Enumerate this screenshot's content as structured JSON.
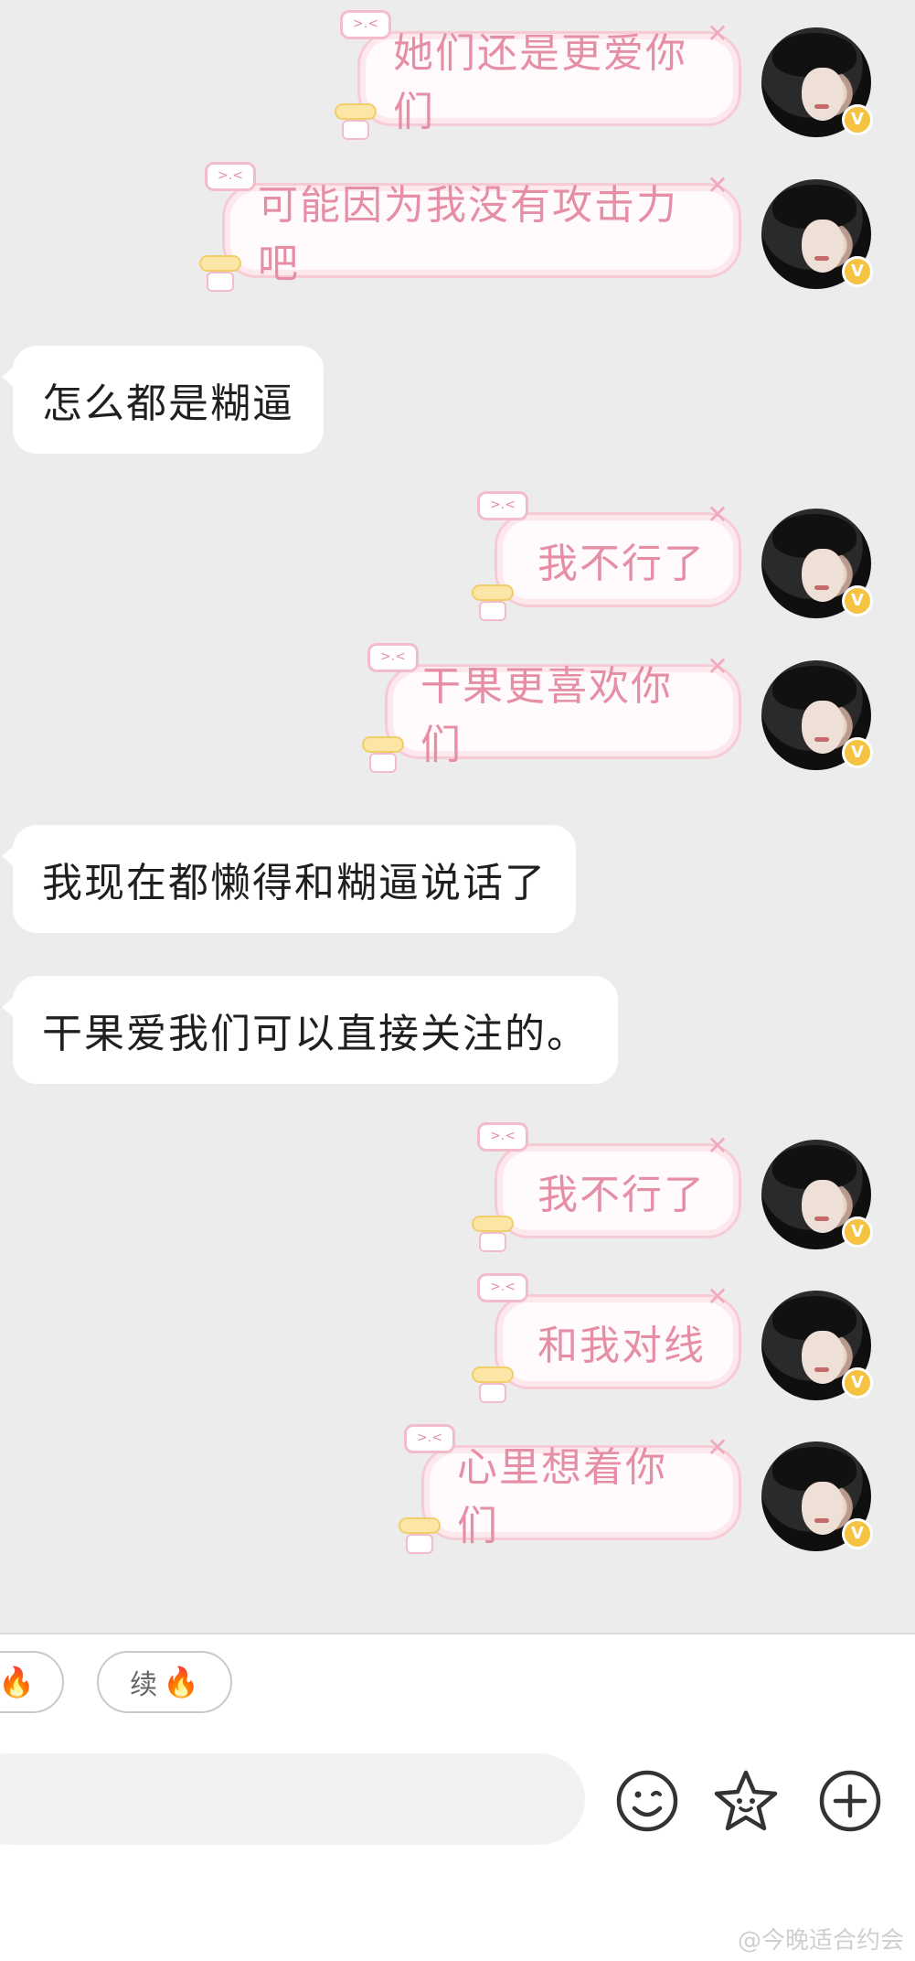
{
  "messages": [
    {
      "side": "out",
      "text": "她们还是更爱你们",
      "deco_tag": ">.<"
    },
    {
      "side": "out",
      "text": "可能因为我没有攻击力吧",
      "deco_tag": ">.<"
    },
    {
      "side": "in",
      "text": "怎么都是糊逼"
    },
    {
      "side": "out",
      "text": "我不行了",
      "deco_tag": ">.<"
    },
    {
      "side": "out",
      "text": "干果更喜欢你们",
      "deco_tag": ">.<"
    },
    {
      "side": "in",
      "text": "我现在都懒得和糊逼说话了"
    },
    {
      "side": "in",
      "text": "干果爱我们可以直接关注的。"
    },
    {
      "side": "out",
      "text": "我不行了",
      "deco_tag": ">.<"
    },
    {
      "side": "out",
      "text": "和我对线",
      "deco_tag": ">.<"
    },
    {
      "side": "out",
      "text": "心里想着你们",
      "deco_tag": ">.<"
    }
  ],
  "avatar_badge": "V",
  "quick_chips": [
    {
      "label": "",
      "icon": "fire-icon"
    },
    {
      "label": "续",
      "icon": "fire-icon"
    }
  ],
  "toolbar": {
    "emoji_icon": "smiley-icon",
    "sticker_icon": "star-face-icon",
    "more_icon": "plus-circle-icon"
  },
  "watermark": "@今晚适合约会",
  "colors": {
    "chat_bg": "#ececec",
    "out_text": "#e58ea6",
    "out_border": "#f6cbd6",
    "badge": "#f5c242"
  }
}
